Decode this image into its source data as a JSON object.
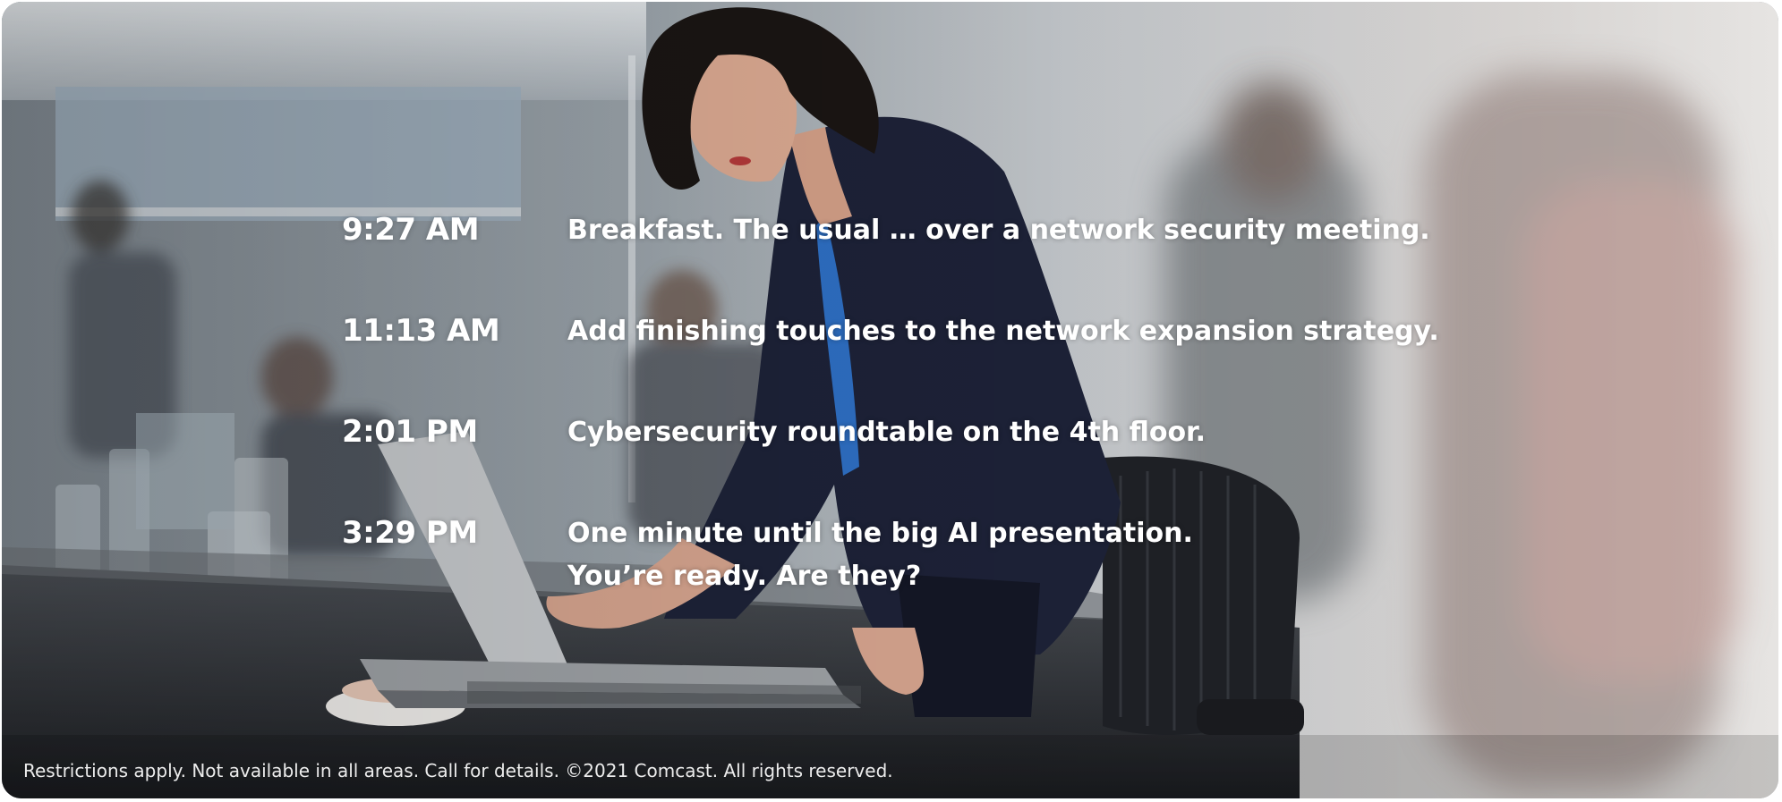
{
  "schedule": [
    {
      "time": "9:27 AM",
      "lines": [
        "Breakfast. The usual … over a network security meeting."
      ]
    },
    {
      "time": "11:13 AM",
      "lines": [
        "Add finishing touches to the network expansion strategy."
      ]
    },
    {
      "time": "2:01 PM",
      "lines": [
        "Cybersecurity roundtable on the 4th floor."
      ]
    },
    {
      "time": "3:29 PM",
      "lines": [
        "One minute until the big AI presentation.",
        "You’re ready. Are they?"
      ]
    }
  ],
  "disclaimer": "Restrictions apply. Not available in all areas. Call for details. ©2021 Comcast. All rights reserved.",
  "photo": {
    "subject": "woman-working-on-laptop-in-office",
    "colors": {
      "background": "#8f959b",
      "blazer": "#1d2238",
      "text": "#ffffff"
    }
  }
}
